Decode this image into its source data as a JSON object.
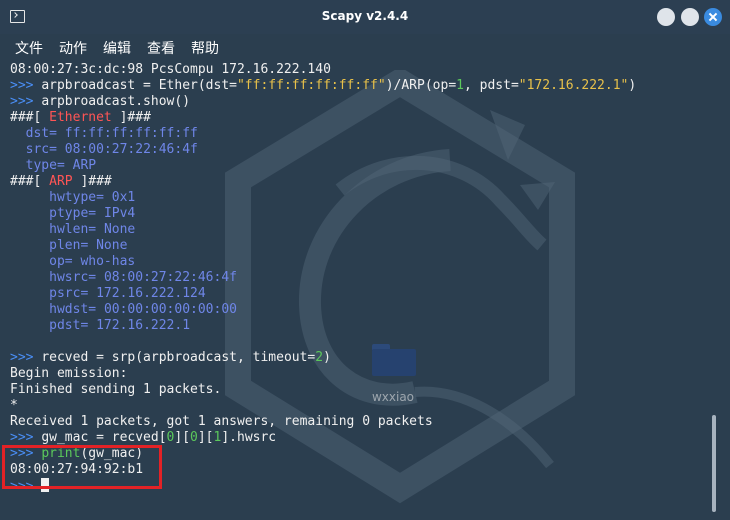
{
  "window": {
    "title": "Scapy v2.4.4"
  },
  "menu": [
    "文件",
    "动作",
    "编辑",
    "查看",
    "帮助"
  ],
  "watermark": "wxxiao",
  "colors": {
    "prompt": "#4a8ff7",
    "string": "#e8c14a",
    "number": "#5bc85b",
    "layer_name": "#ff5555",
    "field": "#6f86e8",
    "highlight_border": "#e32226"
  },
  "terminal": {
    "lines": [
      [
        {
          "t": "08:00:27:3c:dc:98 PcsCompu 172.16.222.140"
        }
      ],
      [
        {
          "t": ">>> ",
          "c": "p"
        },
        {
          "t": "arpbroadcast = Ether(dst="
        },
        {
          "t": "\"ff:ff:ff:ff:ff:ff\"",
          "c": "s"
        },
        {
          "t": ")/ARP(op="
        },
        {
          "t": "1",
          "c": "n"
        },
        {
          "t": ", pdst="
        },
        {
          "t": "\"172.16.222.1\"",
          "c": "s"
        },
        {
          "t": ")"
        }
      ],
      [
        {
          "t": ">>> ",
          "c": "p"
        },
        {
          "t": "arpbroadcast.show()"
        }
      ],
      [
        {
          "t": "###[ "
        },
        {
          "t": "Ethernet",
          "c": "red"
        },
        {
          "t": " ]###"
        }
      ],
      [
        {
          "t": "  dst",
          "c": "blue"
        },
        {
          "t": "= ",
          "c": "blue"
        },
        {
          "t": "ff:ff:ff:ff:ff:ff",
          "c": "blue"
        }
      ],
      [
        {
          "t": "  src",
          "c": "blue"
        },
        {
          "t": "= ",
          "c": "blue"
        },
        {
          "t": "08:00:27:22:46:4f",
          "c": "blue"
        }
      ],
      [
        {
          "t": "  type",
          "c": "blue"
        },
        {
          "t": "= ",
          "c": "blue"
        },
        {
          "t": "ARP",
          "c": "blue"
        }
      ],
      [
        {
          "t": "###[ "
        },
        {
          "t": "ARP",
          "c": "red"
        },
        {
          "t": " ]###"
        }
      ],
      [
        {
          "t": "     hwtype",
          "c": "blue"
        },
        {
          "t": "= ",
          "c": "blue"
        },
        {
          "t": "0x1",
          "c": "blue"
        }
      ],
      [
        {
          "t": "     ptype",
          "c": "blue"
        },
        {
          "t": "= ",
          "c": "blue"
        },
        {
          "t": "IPv4",
          "c": "blue"
        }
      ],
      [
        {
          "t": "     hwlen",
          "c": "blue"
        },
        {
          "t": "= ",
          "c": "blue"
        },
        {
          "t": "None",
          "c": "blue"
        }
      ],
      [
        {
          "t": "     plen",
          "c": "blue"
        },
        {
          "t": "= ",
          "c": "blue"
        },
        {
          "t": "None",
          "c": "blue"
        }
      ],
      [
        {
          "t": "     op",
          "c": "blue"
        },
        {
          "t": "= ",
          "c": "blue"
        },
        {
          "t": "who-has",
          "c": "blue"
        }
      ],
      [
        {
          "t": "     hwsrc",
          "c": "blue"
        },
        {
          "t": "= ",
          "c": "blue"
        },
        {
          "t": "08:00:27:22:46:4f",
          "c": "blue"
        }
      ],
      [
        {
          "t": "     psrc",
          "c": "blue"
        },
        {
          "t": "= ",
          "c": "blue"
        },
        {
          "t": "172.16.222.124",
          "c": "blue"
        }
      ],
      [
        {
          "t": "     hwdst",
          "c": "blue"
        },
        {
          "t": "= ",
          "c": "blue"
        },
        {
          "t": "00:00:00:00:00:00",
          "c": "blue"
        }
      ],
      [
        {
          "t": "     pdst",
          "c": "blue"
        },
        {
          "t": "= ",
          "c": "blue"
        },
        {
          "t": "172.16.222.1",
          "c": "blue"
        }
      ],
      [
        {
          "t": ""
        }
      ],
      [
        {
          "t": ">>> ",
          "c": "p"
        },
        {
          "t": "recved = srp(arpbroadcast, timeout="
        },
        {
          "t": "2",
          "c": "n"
        },
        {
          "t": ")"
        }
      ],
      [
        {
          "t": "Begin emission:"
        }
      ],
      [
        {
          "t": "Finished sending 1 packets."
        }
      ],
      [
        {
          "t": "*"
        }
      ],
      [
        {
          "t": "Received 1 packets, got 1 answers, remaining 0 packets"
        }
      ],
      [
        {
          "t": ">>> ",
          "c": "p"
        },
        {
          "t": "gw_mac = recved["
        },
        {
          "t": "0",
          "c": "n"
        },
        {
          "t": "]["
        },
        {
          "t": "0",
          "c": "n"
        },
        {
          "t": "]["
        },
        {
          "t": "1",
          "c": "n"
        },
        {
          "t": "].hwsrc"
        }
      ],
      [
        {
          "t": ">>> ",
          "c": "p"
        },
        {
          "t": "print",
          "c": "n"
        },
        {
          "t": "(gw_mac)"
        }
      ],
      [
        {
          "t": "08:00:27:94:92:b1"
        }
      ],
      [
        {
          "t": ">>> ",
          "c": "p"
        },
        {
          "cursor": true
        }
      ]
    ]
  }
}
